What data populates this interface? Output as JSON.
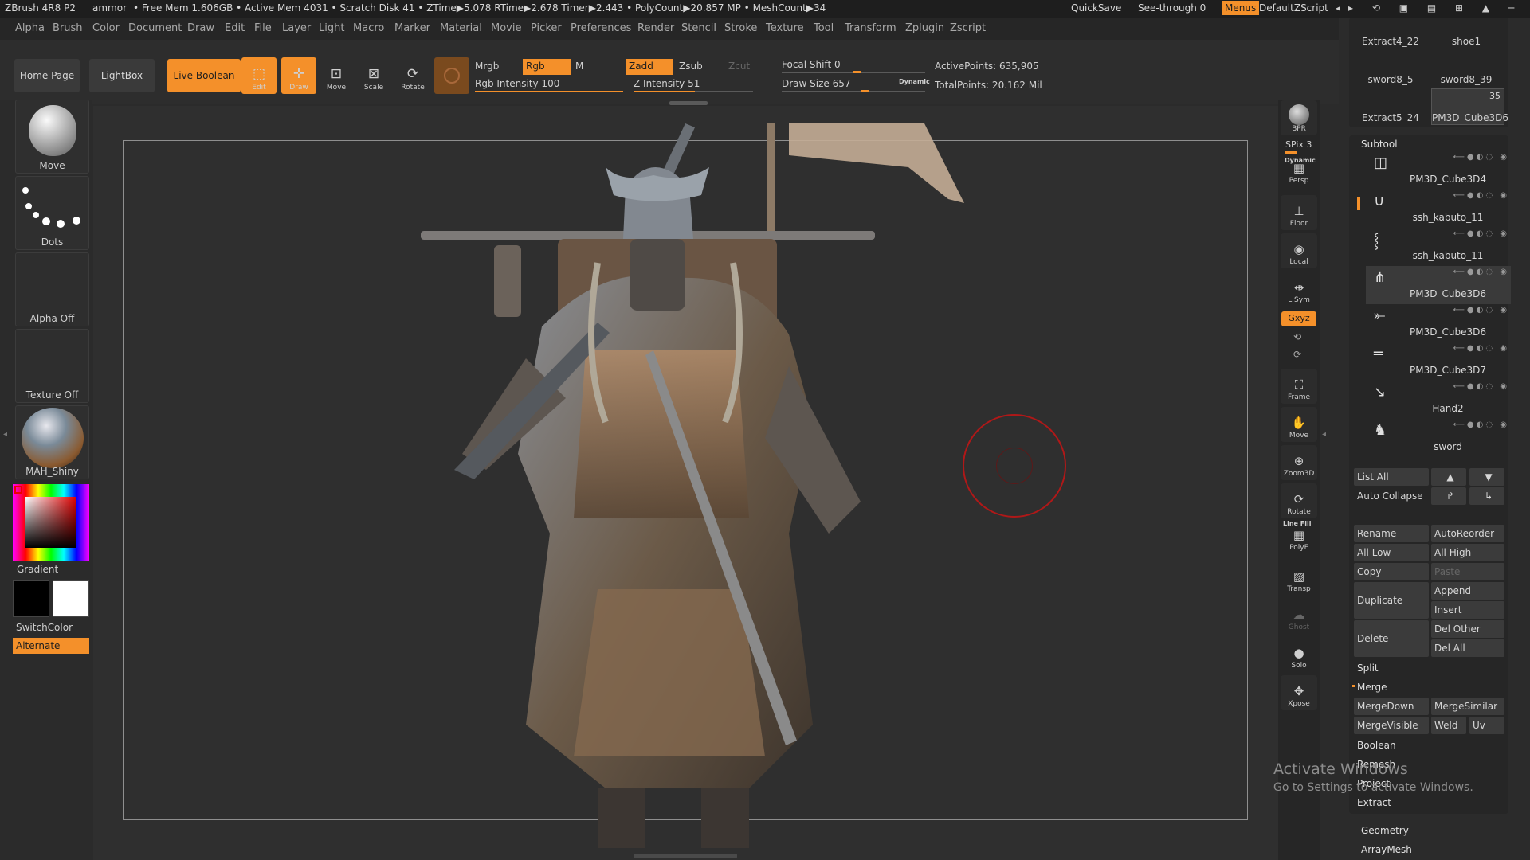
{
  "titlebar": {
    "app": "ZBrush 4R8 P2",
    "doc": "ammor",
    "stats": "• Free Mem 1.606GB • Active Mem 4031 • Scratch Disk 41 • ZTime▶5.078 RTime▶2.678 Timer▶2.443 • PolyCount▶20.857 MP • MeshCount▶34",
    "quicksave": "QuickSave",
    "seethrough": "See-through 0",
    "menus": "Menus",
    "defaultscript": "DefaultZScript"
  },
  "menu": [
    "Alpha",
    "Brush",
    "Color",
    "Document",
    "Draw",
    "Edit",
    "File",
    "Layer",
    "Light",
    "Macro",
    "Marker",
    "Material",
    "Movie",
    "Picker",
    "Preferences",
    "Render",
    "Stencil",
    "Stroke",
    "Texture",
    "Tool",
    "Transform",
    "Zplugin",
    "Zscript"
  ],
  "shelf": {
    "home": "Home Page",
    "lightbox": "LightBox",
    "liveboolean": "Live Boolean",
    "tools": [
      "Edit",
      "Draw",
      "Move",
      "Scale",
      "Rotate"
    ],
    "mrgb": "Mrgb",
    "rgb": "Rgb",
    "m": "M",
    "zadd": "Zadd",
    "zsub": "Zsub",
    "zcut": "Zcut",
    "rgb_intensity": "Rgb Intensity 100",
    "z_intensity": "Z Intensity 51",
    "focal_shift": "Focal Shift 0",
    "draw_size": "Draw Size 657",
    "dynamic": "Dynamic",
    "active_points": "ActivePoints: 635,905",
    "total_points": "TotalPoints: 20.162 Mil",
    "rgb_intensity_value": 100,
    "z_intensity_value": 51,
    "focal_value": 0.5,
    "drawsize_value": 0.55
  },
  "left": {
    "brush": "Move",
    "stroke": "Dots",
    "alpha": "Alpha Off",
    "texture": "Texture Off",
    "material": "MAH_Shiny",
    "gradient": "Gradient",
    "switchcolor": "SwitchColor",
    "alternate": "Alternate"
  },
  "rightstrip": {
    "bpr": "BPR",
    "spix": "SPix 3",
    "items": [
      "Persp",
      "Floor",
      "Local",
      "L.Sym",
      "Frame",
      "Move",
      "Zoom3D",
      "Rotate",
      "PolyF",
      "Transp",
      "Ghost",
      "Solo",
      "Xpose"
    ],
    "xyz": "Gxyz",
    "dynamic": "Dynamic",
    "linefill": "Line Fill"
  },
  "toolthumbs": [
    "Extract4_22",
    "shoe1",
    "sword8_5",
    "sword8_39",
    "Extract5_24",
    "PM3D_Cube3D6"
  ],
  "toolcount": "35",
  "subtool": {
    "title": "Subtool",
    "items": [
      "PM3D_Cube3D4",
      "ssh_kabuto_11",
      "ssh_kabuto_11",
      "PM3D_Cube3D6",
      "PM3D_Cube3D6",
      "PM3D_Cube3D7",
      "Hand2",
      "sword"
    ]
  },
  "buttons": {
    "listall": "List All",
    "autocollapse": "Auto Collapse",
    "rename": "Rename",
    "autoreorder": "AutoReorder",
    "alllow": "All Low",
    "allhigh": "All High",
    "copy": "Copy",
    "paste": "Paste",
    "duplicate": "Duplicate",
    "append": "Append",
    "insert": "Insert",
    "delete": "Delete",
    "delother": "Del Other",
    "delall": "Del All",
    "split": "Split",
    "merge": "Merge",
    "mergedown": "MergeDown",
    "mergesimilar": "MergeSimilar",
    "mergevisible": "MergeVisible",
    "weld": "Weld",
    "uv": "Uv",
    "boolean": "Boolean",
    "remesh": "Remesh",
    "project": "Project",
    "extract": "Extract",
    "geometry": "Geometry",
    "arraymesh": "ArrayMesh"
  },
  "watermark": {
    "line1": "Activate Windows",
    "line2": "Go to Settings to activate Windows."
  },
  "colors": {
    "accent": "#f4902a",
    "bg": "#2b2b2b",
    "frame": "#8f8f8f",
    "cursor": "#b01818"
  }
}
